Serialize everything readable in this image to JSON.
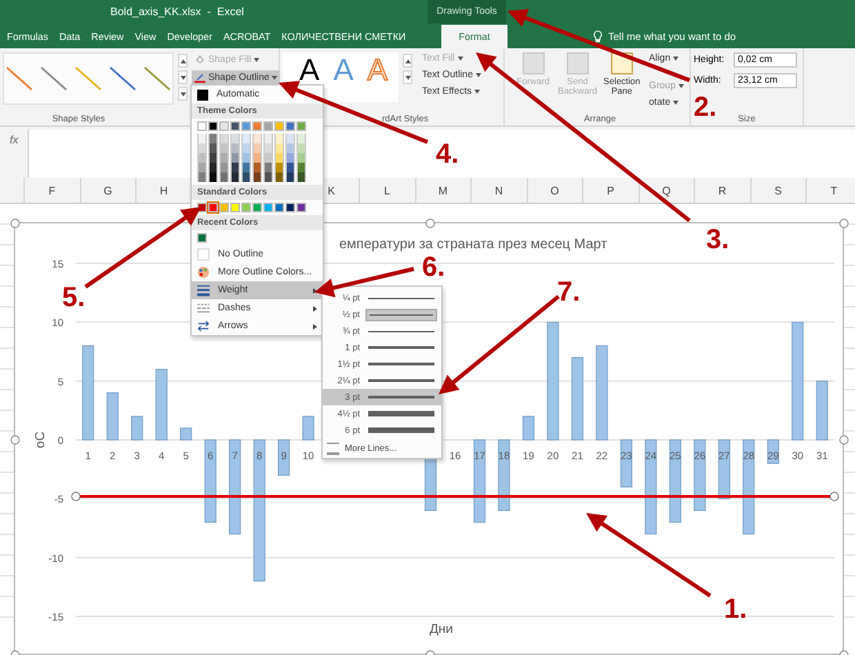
{
  "window": {
    "title": "Bold_axis_KK.xlsx  -  Excel",
    "context_tab_group": "Drawing Tools"
  },
  "tabs": [
    {
      "label": "Formulas",
      "selected": false
    },
    {
      "label": "Data",
      "selected": false
    },
    {
      "label": "Review",
      "selected": false
    },
    {
      "label": "View",
      "selected": false
    },
    {
      "label": "Developer",
      "selected": false
    },
    {
      "label": "ACROBAT",
      "selected": false
    },
    {
      "label": "КОЛИЧЕСТВЕНИ СМЕТКИ",
      "selected": false
    },
    {
      "label": "Format",
      "selected": true
    }
  ],
  "tell_me": "Tell me what you want to do",
  "ribbon": {
    "shape_styles": {
      "label": "Shape Styles",
      "shape_fill": "Shape Fill",
      "shape_outline": "Shape Outline"
    },
    "wordart": {
      "samples": [
        {
          "text": "A",
          "kind": "black"
        },
        {
          "text": "A",
          "kind": "blue"
        },
        {
          "text": "A",
          "kind": "outline"
        }
      ],
      "label": "rdArt Styles",
      "text_fill": "Text Fill",
      "text_outline": "Text Outline",
      "text_effects": "Text Effects"
    },
    "arrange": {
      "label": "Arrange",
      "bring_forward": "Forward",
      "send_backward": "Send\nBackward",
      "selection_pane": "Selection\nPane",
      "align": "Align",
      "group": "Group",
      "rotate": "otate"
    },
    "size": {
      "label": "Size",
      "height_label": "Height:",
      "height": "0,02 cm",
      "width_label": "Width:",
      "width": "23,12 cm"
    }
  },
  "formula_bar": {
    "fx": "fx"
  },
  "column_headers": [
    "F",
    "G",
    "H",
    "K",
    "L",
    "M",
    "N",
    "O",
    "P",
    "Q",
    "R",
    "S",
    "T"
  ],
  "shape_outline_menu": {
    "automatic": "Automatic",
    "theme_label": "Theme Colors",
    "theme_colors": [
      {
        "color": "#ffffff"
      },
      {
        "color": "#000000"
      },
      {
        "color": "#e7e6e6"
      },
      {
        "color": "#44546a"
      },
      {
        "color": "#5b9bd5"
      },
      {
        "color": "#ed7d31"
      },
      {
        "color": "#a5a5a5"
      },
      {
        "color": "#ffc000"
      },
      {
        "color": "#4472c4"
      },
      {
        "color": "#70ad47"
      }
    ],
    "standard_label": "Standard Colors",
    "standard_colors": [
      {
        "color": "#c00000",
        "selected": false
      },
      {
        "color": "#ff0000",
        "selected": true
      },
      {
        "color": "#ffc000",
        "selected": false
      },
      {
        "color": "#ffff00",
        "selected": false
      },
      {
        "color": "#92d050",
        "selected": false
      },
      {
        "color": "#00b050",
        "selected": false
      },
      {
        "color": "#00b0f0",
        "selected": false
      },
      {
        "color": "#0070c0",
        "selected": false
      },
      {
        "color": "#002060",
        "selected": false
      },
      {
        "color": "#7030a0",
        "selected": false
      }
    ],
    "recent_label": "Recent Colors",
    "recent_colors": [
      {
        "color": "#00703c"
      }
    ],
    "items": [
      {
        "label": "No Outline",
        "kind": "none",
        "highlighted": false,
        "submenu": false
      },
      {
        "label": "More Outline Colors...",
        "kind": "palette",
        "highlighted": false,
        "submenu": false
      },
      {
        "label": "Weight",
        "kind": "weight",
        "highlighted": true,
        "submenu": true
      },
      {
        "label": "Dashes",
        "kind": "dashes",
        "highlighted": false,
        "submenu": true
      },
      {
        "label": "Arrows",
        "kind": "arrows",
        "highlighted": false,
        "submenu": true
      }
    ]
  },
  "weight_menu": {
    "items": [
      {
        "label": "¼ pt",
        "selected": false,
        "highlighted": false
      },
      {
        "label": "½ pt",
        "selected": true,
        "highlighted": false
      },
      {
        "label": "¾ pt",
        "selected": false,
        "highlighted": false
      },
      {
        "label": "1 pt",
        "selected": false,
        "highlighted": false
      },
      {
        "label": "1½ pt",
        "selected": false,
        "highlighted": false
      },
      {
        "label": "2¼ pt",
        "selected": false,
        "highlighted": false
      },
      {
        "label": "3 pt",
        "selected": false,
        "highlighted": true
      },
      {
        "label": "4½ pt",
        "selected": false,
        "highlighted": false
      },
      {
        "label": "6 pt",
        "selected": false,
        "highlighted": false
      }
    ],
    "more": "More Lines..."
  },
  "chart": {
    "chart_data": {
      "type": "bar",
      "title": "емператури за страната през месец Март",
      "xlabel": "Дни",
      "ylabel": "оС",
      "x": [
        1,
        2,
        3,
        4,
        5,
        6,
        7,
        8,
        9,
        10,
        15,
        17,
        18,
        19,
        20,
        21,
        22,
        23,
        24,
        25,
        26,
        27,
        28,
        29,
        30,
        31
      ],
      "xticks": [
        1,
        2,
        3,
        4,
        5,
        6,
        7,
        8,
        9,
        10,
        16,
        17,
        18,
        19,
        20,
        21,
        22,
        23,
        24,
        25,
        26,
        27,
        28,
        29,
        30,
        31
      ],
      "values": [
        8,
        4,
        2,
        6,
        1,
        -7,
        -8,
        -12,
        -3,
        2,
        -6,
        -7,
        -6,
        2,
        10,
        7,
        8,
        -4,
        -8,
        -7,
        -6,
        -5,
        -8,
        -2,
        10,
        5
      ],
      "xlim": [
        0.5,
        31.5
      ],
      "ylim": [
        -15,
        15
      ],
      "yticks": [
        -15,
        -10,
        -5,
        0,
        5,
        10,
        15
      ],
      "grid": true
    }
  },
  "callouts": [
    "1.",
    "2.",
    "3.",
    "4.",
    "5.",
    "6.",
    "7."
  ]
}
